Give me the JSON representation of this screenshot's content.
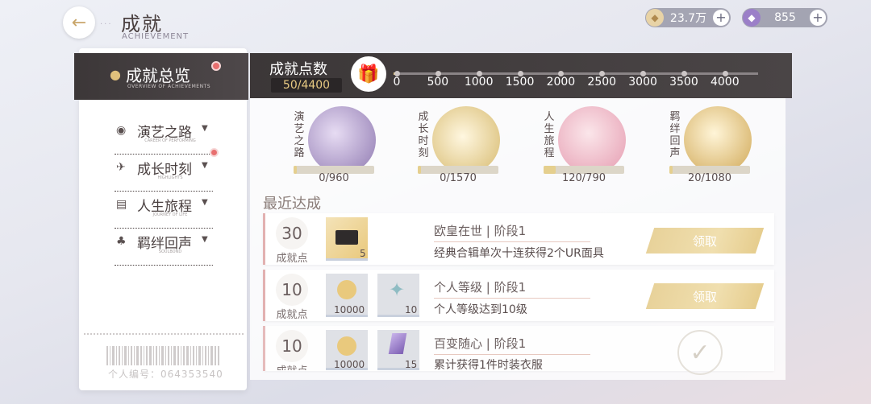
{
  "header": {
    "back_icon": "arrow-left-icon",
    "title": "成就",
    "subtitle": "ACHIEVEMENT"
  },
  "currencies": [
    {
      "icon": "coin-icon",
      "value": "23.7万"
    },
    {
      "icon": "gem-icon",
      "value": "855"
    }
  ],
  "sidebar": {
    "overview": {
      "title": "成就总览",
      "subtitle": "OVERVIEW OF ACHIEVEMENTS"
    },
    "items": [
      {
        "label": "演艺之路",
        "sub": "CAREER OF PERFORMING",
        "icon": "video-camera-icon"
      },
      {
        "label": "成长时刻",
        "sub": "HIGHLIGHTS",
        "icon": "airplane-icon"
      },
      {
        "label": "人生旅程",
        "sub": "JOURNEY OF LIFE",
        "icon": "document-icon"
      },
      {
        "label": "羁绊回声",
        "sub": "SOULBOND",
        "icon": "clover-icon"
      }
    ],
    "user_id": "个人编号：0643535​40"
  },
  "points": {
    "title": "成就点数",
    "value": "50/4400",
    "progress": 0.011,
    "ticks": [
      "0",
      "500",
      "1000",
      "1500",
      "2000",
      "2500",
      "3000",
      "3500",
      "4000"
    ]
  },
  "categories": [
    {
      "label": "演艺之路",
      "progress": "0/960",
      "fill": 0.0
    },
    {
      "label": "成长时刻",
      "progress": "0/1570",
      "fill": 0.0
    },
    {
      "label": "人生旅程",
      "progress": "120/790",
      "fill": 0.15
    },
    {
      "label": "羁绊回声",
      "progress": "20/1080",
      "fill": 0.02
    }
  ],
  "recent": {
    "title": "最近达成",
    "points_label": "成就点",
    "claim_label": "领取",
    "items": [
      {
        "points": "30",
        "name": "欧皇在世 | 阶段1",
        "desc": "经典合辑单次十连获得2个UR面具",
        "rewards": [
          {
            "icon": "ticket-icon",
            "qty": "5"
          }
        ]
      },
      {
        "points": "10",
        "name": "个人等级 | 阶段1",
        "desc": "个人等级达到10级",
        "rewards": [
          {
            "icon": "coin-icon",
            "qty": "10000"
          },
          {
            "icon": "star-shard-icon",
            "qty": "10"
          }
        ]
      },
      {
        "points": "10",
        "name": "百变随心 | 阶段1",
        "desc": "累计获得1件时装衣服",
        "rewards": [
          {
            "icon": "coin-icon",
            "qty": "10000"
          },
          {
            "icon": "gem-icon",
            "qty": "15"
          }
        ]
      }
    ]
  },
  "colors": {
    "accent_gold": "#e7c982",
    "dark_bar": "#3c3738",
    "red_dot": "#e86f6f"
  }
}
